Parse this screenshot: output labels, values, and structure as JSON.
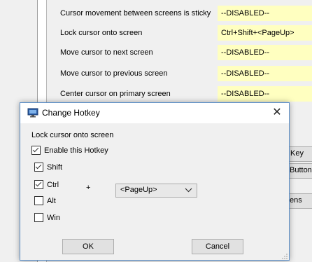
{
  "background": {
    "settings_rows": [
      {
        "label": "Cursor movement between screens is sticky",
        "value": "--DISABLED--"
      },
      {
        "label": "Lock cursor onto screen",
        "value": "Ctrl+Shift+<PageUp>"
      },
      {
        "label": "Move cursor to next screen",
        "value": "--DISABLED--"
      },
      {
        "label": "Move cursor to previous screen",
        "value": "--DISABLED--"
      },
      {
        "label": "Center cursor on primary screen",
        "value": "--DISABLED--"
      }
    ],
    "side_buttons": {
      "key": "Key",
      "button": "Button",
      "screens": "ens"
    }
  },
  "dialog": {
    "title": "Change Hotkey",
    "title_icon": "monitor-icon",
    "close_glyph": "✕",
    "action_label": "Lock cursor onto screen",
    "enable_label": "Enable this Hotkey",
    "enable_checked": true,
    "modifiers": [
      {
        "label": "Shift",
        "checked": true
      },
      {
        "label": "Ctrl",
        "checked": true
      },
      {
        "label": "Alt",
        "checked": false
      },
      {
        "label": "Win",
        "checked": false
      }
    ],
    "plus": "+",
    "key_select": "<PageUp>",
    "ok_label": "OK",
    "cancel_label": "Cancel"
  }
}
